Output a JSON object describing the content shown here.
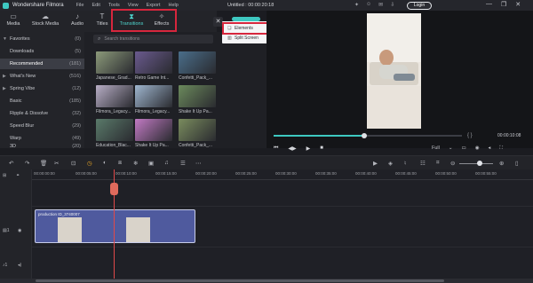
{
  "app": {
    "name": "Wondershare Filmora",
    "menu": [
      "File",
      "Edit",
      "Tools",
      "View",
      "Export",
      "Help"
    ],
    "document_title": "Untitled : 00:00:20:18",
    "login_label": "Login",
    "window_controls": [
      "—",
      "❐",
      "✕"
    ]
  },
  "tabs": [
    {
      "label": "Media",
      "icon": "folder-icon"
    },
    {
      "label": "Stock Media",
      "icon": "cloud-icon"
    },
    {
      "label": "Audio",
      "icon": "music-icon"
    },
    {
      "label": "Titles",
      "icon": "text-icon"
    },
    {
      "label": "Transitions",
      "icon": "transitions-icon",
      "active": true
    },
    {
      "label": "Effects",
      "icon": "effects-icon"
    }
  ],
  "dropdown": {
    "items": [
      {
        "label": "Elements",
        "icon": "elements-icon"
      },
      {
        "label": "Split Screen",
        "icon": "split-screen-icon"
      }
    ]
  },
  "sidebar": {
    "items": [
      {
        "label": "Favorites",
        "count": "(0)",
        "chevron": "▼",
        "level": 0
      },
      {
        "label": "Downloads",
        "count": "(5)",
        "level": 1
      },
      {
        "label": "Recommended",
        "count": "(181)",
        "level": 0,
        "selected": true
      },
      {
        "label": "What's New",
        "count": "(516)",
        "chevron": "▶",
        "level": 0
      },
      {
        "label": "Spring Vibe",
        "count": "(12)",
        "chevron": "▶",
        "level": 0
      },
      {
        "label": "Basic",
        "count": "(185)",
        "level": 1
      },
      {
        "label": "Ripple & Dissolve",
        "count": "(32)",
        "level": 1
      },
      {
        "label": "Speed Blur",
        "count": "(29)",
        "level": 1
      },
      {
        "label": "Warp",
        "count": "(49)",
        "level": 1
      },
      {
        "label": "3D",
        "count": "(20)",
        "level": 1
      }
    ]
  },
  "browser": {
    "search_placeholder": "Search transitions",
    "thumbnails": [
      {
        "label": "Japanese_Grad...",
        "color": "#8c9a7a"
      },
      {
        "label": "Retro Game Int...",
        "color": "#6a5a8e"
      },
      {
        "label": "Confetti_Pack_...",
        "color": "#4a6e8a"
      },
      {
        "label": "Filmora_Legacy...",
        "color": "#b8aec6"
      },
      {
        "label": "Filmora_Legacy...",
        "color": "#9fb6cf"
      },
      {
        "label": "Shake It Up Pa...",
        "color": "#6c8a5c"
      },
      {
        "label": "Education_Blac...",
        "color": "#5a7a6a"
      },
      {
        "label": "Shake It Up Pa...",
        "color": "#c27ac4"
      },
      {
        "label": "Confetti_Pack_...",
        "color": "#7a8c5e"
      }
    ]
  },
  "preview": {
    "timecode": "00:00:10:08",
    "braces": "{     }",
    "progress": 0.48,
    "quality": "Full",
    "controls": [
      "⏮",
      "◀▶",
      "▶",
      "■"
    ]
  },
  "timeline": {
    "ruler_labels": [
      "00:00:00:00",
      "00:00:05:00",
      "00:00:10:00",
      "00:00:15:00",
      "00:00:20:00",
      "00:00:25:00",
      "00:00:30:00",
      "00:00:35:00",
      "00:00:40:00",
      "00:00:45:00",
      "00:00:50:00",
      "00:00:55:00"
    ],
    "clip_title": "production ID_3740007"
  },
  "colors": {
    "accent": "#3ec8c1",
    "highlight": "#d7263d",
    "playhead": "#e04a4a",
    "clip": "#4f5a9e"
  }
}
